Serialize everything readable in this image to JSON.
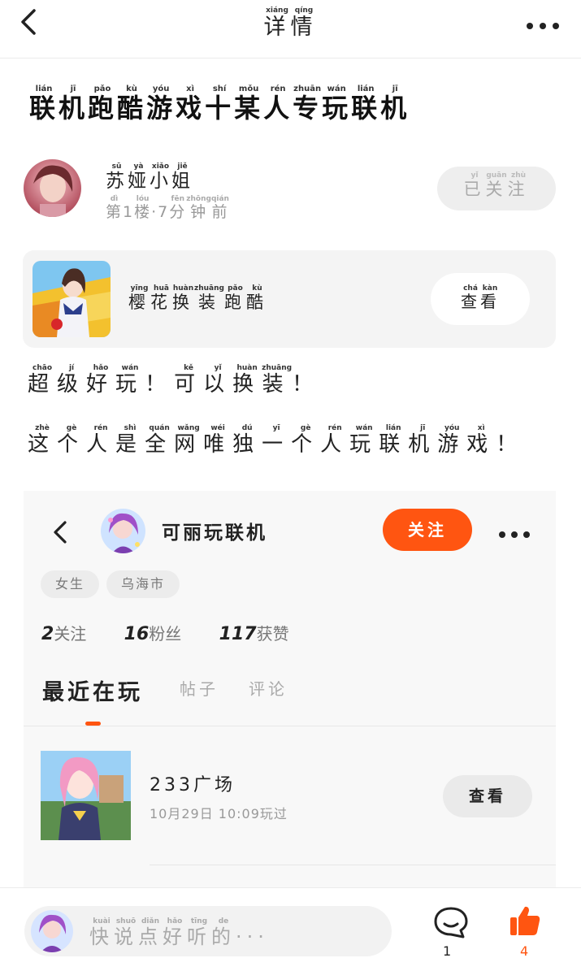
{
  "header": {
    "title": [
      [
        "详",
        "xiáng"
      ],
      [
        "情",
        "qíng"
      ]
    ]
  },
  "post": {
    "title": [
      [
        "联",
        "lián"
      ],
      [
        "机",
        "jī"
      ],
      [
        "跑",
        "pǎo"
      ],
      [
        "酷",
        "kù"
      ],
      [
        "游",
        "yóu"
      ],
      [
        "戏",
        "xì"
      ],
      [
        "十",
        "shí"
      ],
      [
        "某",
        "mǒu"
      ],
      [
        "人",
        "rén"
      ],
      [
        "专",
        "zhuān"
      ],
      [
        "玩",
        "wán"
      ],
      [
        "联",
        "lián"
      ],
      [
        "机",
        "jī"
      ]
    ],
    "author": {
      "name": [
        [
          "苏",
          "sū"
        ],
        [
          "娅",
          "yà"
        ],
        [
          "小",
          "xiǎo"
        ],
        [
          "姐",
          "jiě"
        ]
      ],
      "floor_time": [
        [
          "第",
          "dì"
        ],
        [
          "1",
          ""
        ],
        [
          "楼",
          "lóu"
        ],
        [
          "·",
          ""
        ],
        [
          "7",
          ""
        ],
        [
          "分",
          "fēn"
        ],
        [
          "钟",
          "zhōng"
        ],
        [
          "前",
          "qián"
        ]
      ]
    },
    "followed_label": [
      [
        "已",
        "yǐ"
      ],
      [
        "关",
        "guān"
      ],
      [
        "注",
        "zhù"
      ]
    ],
    "game_card": {
      "name": [
        [
          "樱",
          "yīng"
        ],
        [
          "花",
          "huā"
        ],
        [
          "换",
          "huàn"
        ],
        [
          "装",
          "zhuāng"
        ],
        [
          "跑",
          "pǎo"
        ],
        [
          "酷",
          "kù"
        ]
      ],
      "view_label": [
        [
          "查",
          "chá"
        ],
        [
          "看",
          "kàn"
        ]
      ]
    },
    "body_lines": [
      [
        [
          "超",
          "chāo"
        ],
        [
          "级",
          "jí"
        ],
        [
          "好",
          "hǎo"
        ],
        [
          "玩",
          "wán"
        ],
        [
          "！",
          ""
        ],
        [
          "可",
          "kě"
        ],
        [
          "以",
          "yǐ"
        ],
        [
          "换",
          "huàn"
        ],
        [
          "装",
          "zhuāng"
        ],
        [
          "！",
          ""
        ]
      ],
      [
        [
          "这",
          "zhè"
        ],
        [
          "个",
          "gè"
        ],
        [
          "人",
          "rén"
        ],
        [
          "是",
          "shì"
        ],
        [
          "全",
          "quán"
        ],
        [
          "网",
          "wǎng"
        ],
        [
          "唯",
          "wéi"
        ],
        [
          "独",
          "dú"
        ],
        [
          "一",
          "yī"
        ],
        [
          "个",
          "gè"
        ],
        [
          "人",
          "rén"
        ],
        [
          "玩",
          "wán"
        ],
        [
          "联",
          "lián"
        ],
        [
          "机",
          "jī"
        ],
        [
          "游",
          "yóu"
        ],
        [
          "戏",
          "xì"
        ],
        [
          "！",
          ""
        ]
      ]
    ]
  },
  "embedded_profile": {
    "username": "可丽玩联机",
    "follow_label": "关注",
    "tags": [
      "女生",
      "乌海市"
    ],
    "stats": [
      {
        "num": "2",
        "label": "关注"
      },
      {
        "num": "16",
        "label": "粉丝"
      },
      {
        "num": "117",
        "label": "获赞"
      }
    ],
    "tabs": [
      "最近在玩",
      "帖子",
      "评论"
    ],
    "recent_game": {
      "name": "233广场",
      "time": "10月29日 10:09玩过",
      "view_label": "查看"
    }
  },
  "bottom_bar": {
    "placeholder": [
      [
        "快",
        "kuài"
      ],
      [
        "说",
        "shuō"
      ],
      [
        "点",
        "diǎn"
      ],
      [
        "好",
        "hǎo"
      ],
      [
        "听",
        "tīng"
      ],
      [
        "的",
        "de"
      ],
      [
        "···",
        ""
      ]
    ],
    "comment_count": "1",
    "like_count": "4"
  },
  "colors": {
    "accent": "#ff5511",
    "gray_button": "#eeeeee",
    "card_bg": "#f4f4f4"
  },
  "icons": [
    "back-icon",
    "more-icon",
    "comment-icon",
    "like-icon"
  ]
}
